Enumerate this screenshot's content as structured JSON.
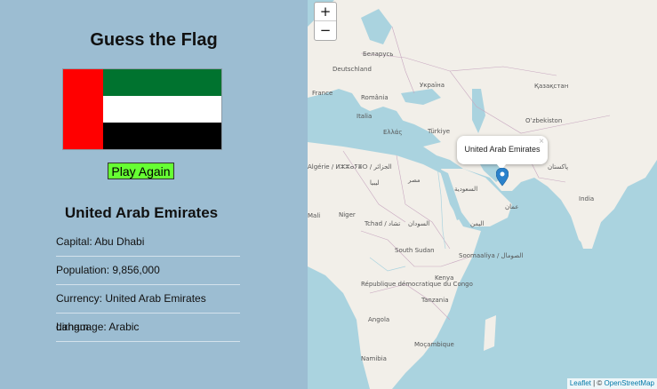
{
  "sidebar": {
    "title": "Guess the Flag",
    "play_again": "Play Again",
    "country_name": "United Arab Emirates",
    "info": [
      "Capital: Abu Dhabi",
      "Population: 9,856,000",
      "Currency: United Arab Emirates dirham",
      "Language: Arabic"
    ],
    "flag_colors": {
      "red": "#ff0000",
      "green": "#00732f",
      "white": "#ffffff",
      "black": "#000000"
    }
  },
  "map": {
    "zoom_in": "+",
    "zoom_out": "−",
    "popup_text": "United Arab Emirates",
    "popup_close": "×",
    "attribution_leaflet": "Leaflet",
    "attribution_sep": " | © ",
    "attribution_osm": "OpenStreetMap",
    "labels": {
      "belarus": "Беларусь",
      "deutschland": "Deutschland",
      "ukraine": "Україна",
      "kazakhstan": "Қазақстан",
      "france": "France",
      "romania": "România",
      "italia": "Italia",
      "uzbekistan": "Oʻzbekiston",
      "turkiye": "Türkiye",
      "ellas": "Ελλάς",
      "algerie": "Algérie / ⵍⵣⵣⴰⵢⴻⵔ / الجزائر",
      "libya": "ليبيا",
      "misr": "مصر",
      "saudi": "السعودية",
      "pakistan": "پاکستان",
      "india": "India",
      "mali": "Mali",
      "niger": "Niger",
      "tchad": "Tchad / تشاد",
      "sudan": "السودان",
      "oman": "عمان",
      "yemen": "اليمن",
      "south_sudan": "South Sudan",
      "somalia": "Soomaaliya / الصومال",
      "kenya": "Kenya",
      "drc": "République démocratique du Congo",
      "tanzania": "Tanzania",
      "angola": "Angola",
      "mocambique": "Moçambique",
      "namibia": "Namibia"
    }
  }
}
